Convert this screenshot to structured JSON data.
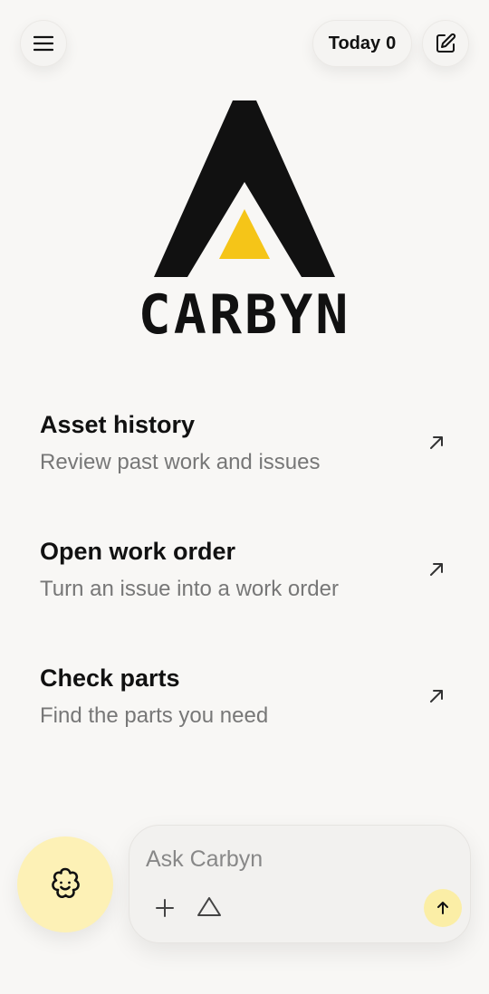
{
  "header": {
    "today_label": "Today",
    "today_count": "0"
  },
  "brand": {
    "name": "CARBYN",
    "colors": {
      "dark": "#111111",
      "accent": "#f5c518"
    }
  },
  "suggestions": [
    {
      "title": "Asset history",
      "subtitle": "Review past work and issues",
      "icon": "arrow-up-right-icon"
    },
    {
      "title": "Open work order",
      "subtitle": "Turn an issue into a work order",
      "icon": "arrow-up-right-icon"
    },
    {
      "title": "Check parts",
      "subtitle": "Find the parts you need",
      "icon": "arrow-up-right-icon"
    }
  ],
  "composer": {
    "placeholder": "Ask Carbyn",
    "value": ""
  },
  "icons": {
    "menu": "hamburger-menu-icon",
    "compose": "edit-compose-icon",
    "assistant": "flower-face-icon",
    "attach": "plus-icon",
    "mode": "triangle-icon",
    "send": "arrow-up-icon"
  }
}
